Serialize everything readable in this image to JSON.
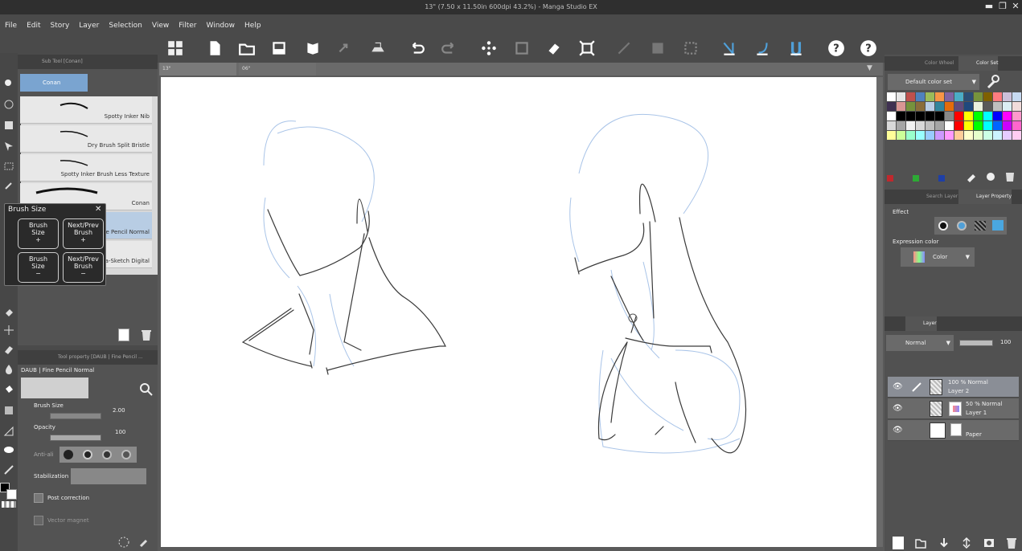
{
  "window": {
    "title": "13\" (7.50 x 11.50in 600dpi 43.2%) - Manga Studio EX"
  },
  "menu": [
    "File",
    "Edit",
    "Story",
    "Layer",
    "Selection",
    "View",
    "Filter",
    "Window",
    "Help"
  ],
  "tabs": [
    {
      "label": "13\""
    },
    {
      "label": "06\""
    }
  ],
  "subtool": {
    "header": "Sub Tool [Conan]",
    "selected": "Conan",
    "brushes": [
      "Spotty Inker Nib",
      "Dry Brush Split Bristle",
      "Spotty Inker Brush Less Texture",
      "Conan",
      "e Pencil Normal",
      "a-Sketch Digital"
    ]
  },
  "popup": {
    "title": "Brush Size",
    "close": "✕",
    "buttons": [
      {
        "line1": "Brush",
        "line2": "Size",
        "sign": "+"
      },
      {
        "line1": "Next/Prev",
        "line2": "Brush",
        "sign": "+"
      },
      {
        "line1": "Brush",
        "line2": "Size",
        "sign": "−"
      },
      {
        "line1": "Next/Prev",
        "line2": "Brush",
        "sign": "−"
      }
    ]
  },
  "toolprop": {
    "header": "Tool property [DAUB | Fine Pencil ...",
    "subtitle": "DAUB | Fine Pencil Normal",
    "brush_size_label": "Brush Size",
    "brush_size_value": "2.00",
    "opacity_label": "Opacity",
    "opacity_value": "100",
    "antialias_label": "Anti-ali",
    "stabilization_label": "Stabilization",
    "post_correction_label": "Post correction",
    "vector_magnet_label": "Vector magnet"
  },
  "color": {
    "tab_wheel": "Color Wheel",
    "tab_set": "Color Set",
    "set_name": "Default color set",
    "swatches": [
      [
        "#ffffff",
        "#e6e6e6",
        "#c0504d",
        "#4f81bd",
        "#9bbb59",
        "#f79646",
        "#8064a2",
        "#4bacc6",
        "#2c4d75",
        "#77933c",
        "#7f6000",
        "#ff7c80",
        "#ccc0da",
        "#c6d9f1"
      ],
      [
        "#3f3151",
        "#d99694",
        "#76923c",
        "#8a6d3b",
        "#b9cde5",
        "#31859c",
        "#e46c0a",
        "#604a7b",
        "#1f497d",
        "#ebf1de",
        "#595959",
        "#bfbfbf",
        "#dbeef4",
        "#f2dcdb"
      ],
      [
        "#ffffff",
        "#000000",
        "#000000",
        "#000000",
        "#000000",
        "#000000",
        "#888888",
        "#ff0000",
        "#ffff00",
        "#00ff00",
        "#00ffff",
        "#0000ff",
        "#ff00ff",
        "#ff99cc"
      ],
      [
        "#d9d9d9",
        "#a6a6a6",
        "#f2f2f2",
        "#d8d8d8",
        "#bfbfbf",
        "#a5a5a5",
        "#ffffff",
        "#ff0000",
        "#ffff00",
        "#00ff00",
        "#00ffff",
        "#0066ff",
        "#cc00ff",
        "#ff66cc"
      ],
      [
        "#ffff99",
        "#ccff99",
        "#99ffcc",
        "#99ffff",
        "#99ccff",
        "#cc99ff",
        "#ff99ff",
        "#ffcc99",
        "#ffffcc",
        "#e6ffcc",
        "#ccffe6",
        "#ccf2ff",
        "#e6ccff",
        "#ffccf2"
      ]
    ]
  },
  "layer_property": {
    "tab_search": "Search Layer",
    "tab_property": "Layer Property",
    "effect_label": "Effect",
    "expression_label": "Expression color",
    "expression_value": "Color"
  },
  "layers": {
    "tab": "Layer",
    "blend_mode": "Normal",
    "opacity": "100",
    "items": [
      {
        "opacity_mode": "100 %  Normal",
        "name": "Layer 2"
      },
      {
        "opacity_mode": "50 %  Normal",
        "name": "Layer 1"
      },
      {
        "opacity_mode": "",
        "name": "Paper"
      }
    ]
  },
  "colors": {
    "accent": "#4f9fd8",
    "panel": "#535353",
    "canvas": "#ffffff"
  }
}
